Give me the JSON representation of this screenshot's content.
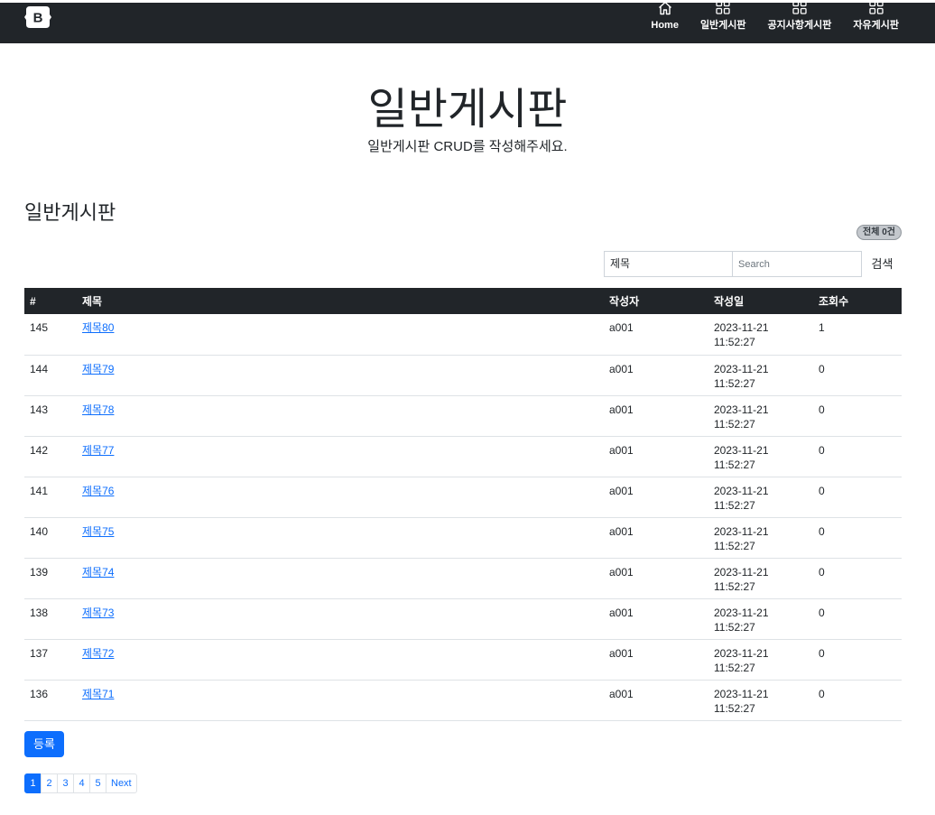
{
  "nav": {
    "items": [
      {
        "label": "Home",
        "icon": "home-icon"
      },
      {
        "label": "일반게시판",
        "icon": "grid-icon"
      },
      {
        "label": "공지사항게시판",
        "icon": "grid-icon"
      },
      {
        "label": "자유게시판",
        "icon": "grid-icon"
      }
    ]
  },
  "logo": {
    "letter": "B"
  },
  "hero": {
    "title": "일반게시판",
    "subtitle": "일반게시판 CRUD를 작성해주세요."
  },
  "section": {
    "title": "일반게시판"
  },
  "badge": {
    "label": "전체 0건"
  },
  "search": {
    "field_value": "제목",
    "placeholder": "Search",
    "button_label": "검색"
  },
  "table": {
    "headers": [
      "#",
      "제목",
      "작성자",
      "작성일",
      "조회수"
    ],
    "rows": [
      {
        "no": "145",
        "title": "제목80",
        "writer": "a001",
        "date": "2023-11-21",
        "time": "11:52:27",
        "views": "1"
      },
      {
        "no": "144",
        "title": "제목79",
        "writer": "a001",
        "date": "2023-11-21",
        "time": "11:52:27",
        "views": "0"
      },
      {
        "no": "143",
        "title": "제목78",
        "writer": "a001",
        "date": "2023-11-21",
        "time": "11:52:27",
        "views": "0"
      },
      {
        "no": "142",
        "title": "제목77",
        "writer": "a001",
        "date": "2023-11-21",
        "time": "11:52:27",
        "views": "0"
      },
      {
        "no": "141",
        "title": "제목76",
        "writer": "a001",
        "date": "2023-11-21",
        "time": "11:52:27",
        "views": "0"
      },
      {
        "no": "140",
        "title": "제목75",
        "writer": "a001",
        "date": "2023-11-21",
        "time": "11:52:27",
        "views": "0"
      },
      {
        "no": "139",
        "title": "제목74",
        "writer": "a001",
        "date": "2023-11-21",
        "time": "11:52:27",
        "views": "0"
      },
      {
        "no": "138",
        "title": "제목73",
        "writer": "a001",
        "date": "2023-11-21",
        "time": "11:52:27",
        "views": "0"
      },
      {
        "no": "137",
        "title": "제목72",
        "writer": "a001",
        "date": "2023-11-21",
        "time": "11:52:27",
        "views": "0"
      },
      {
        "no": "136",
        "title": "제목71",
        "writer": "a001",
        "date": "2023-11-21",
        "time": "11:52:27",
        "views": "0"
      }
    ]
  },
  "register_button": "등록",
  "pagination": {
    "pages": [
      "1",
      "2",
      "3",
      "4",
      "5"
    ],
    "current": "1",
    "next_label": "Next"
  },
  "colors": {
    "navbar_bg": "#212529",
    "primary": "#0d6efd",
    "table_header_bg": "#212529"
  }
}
